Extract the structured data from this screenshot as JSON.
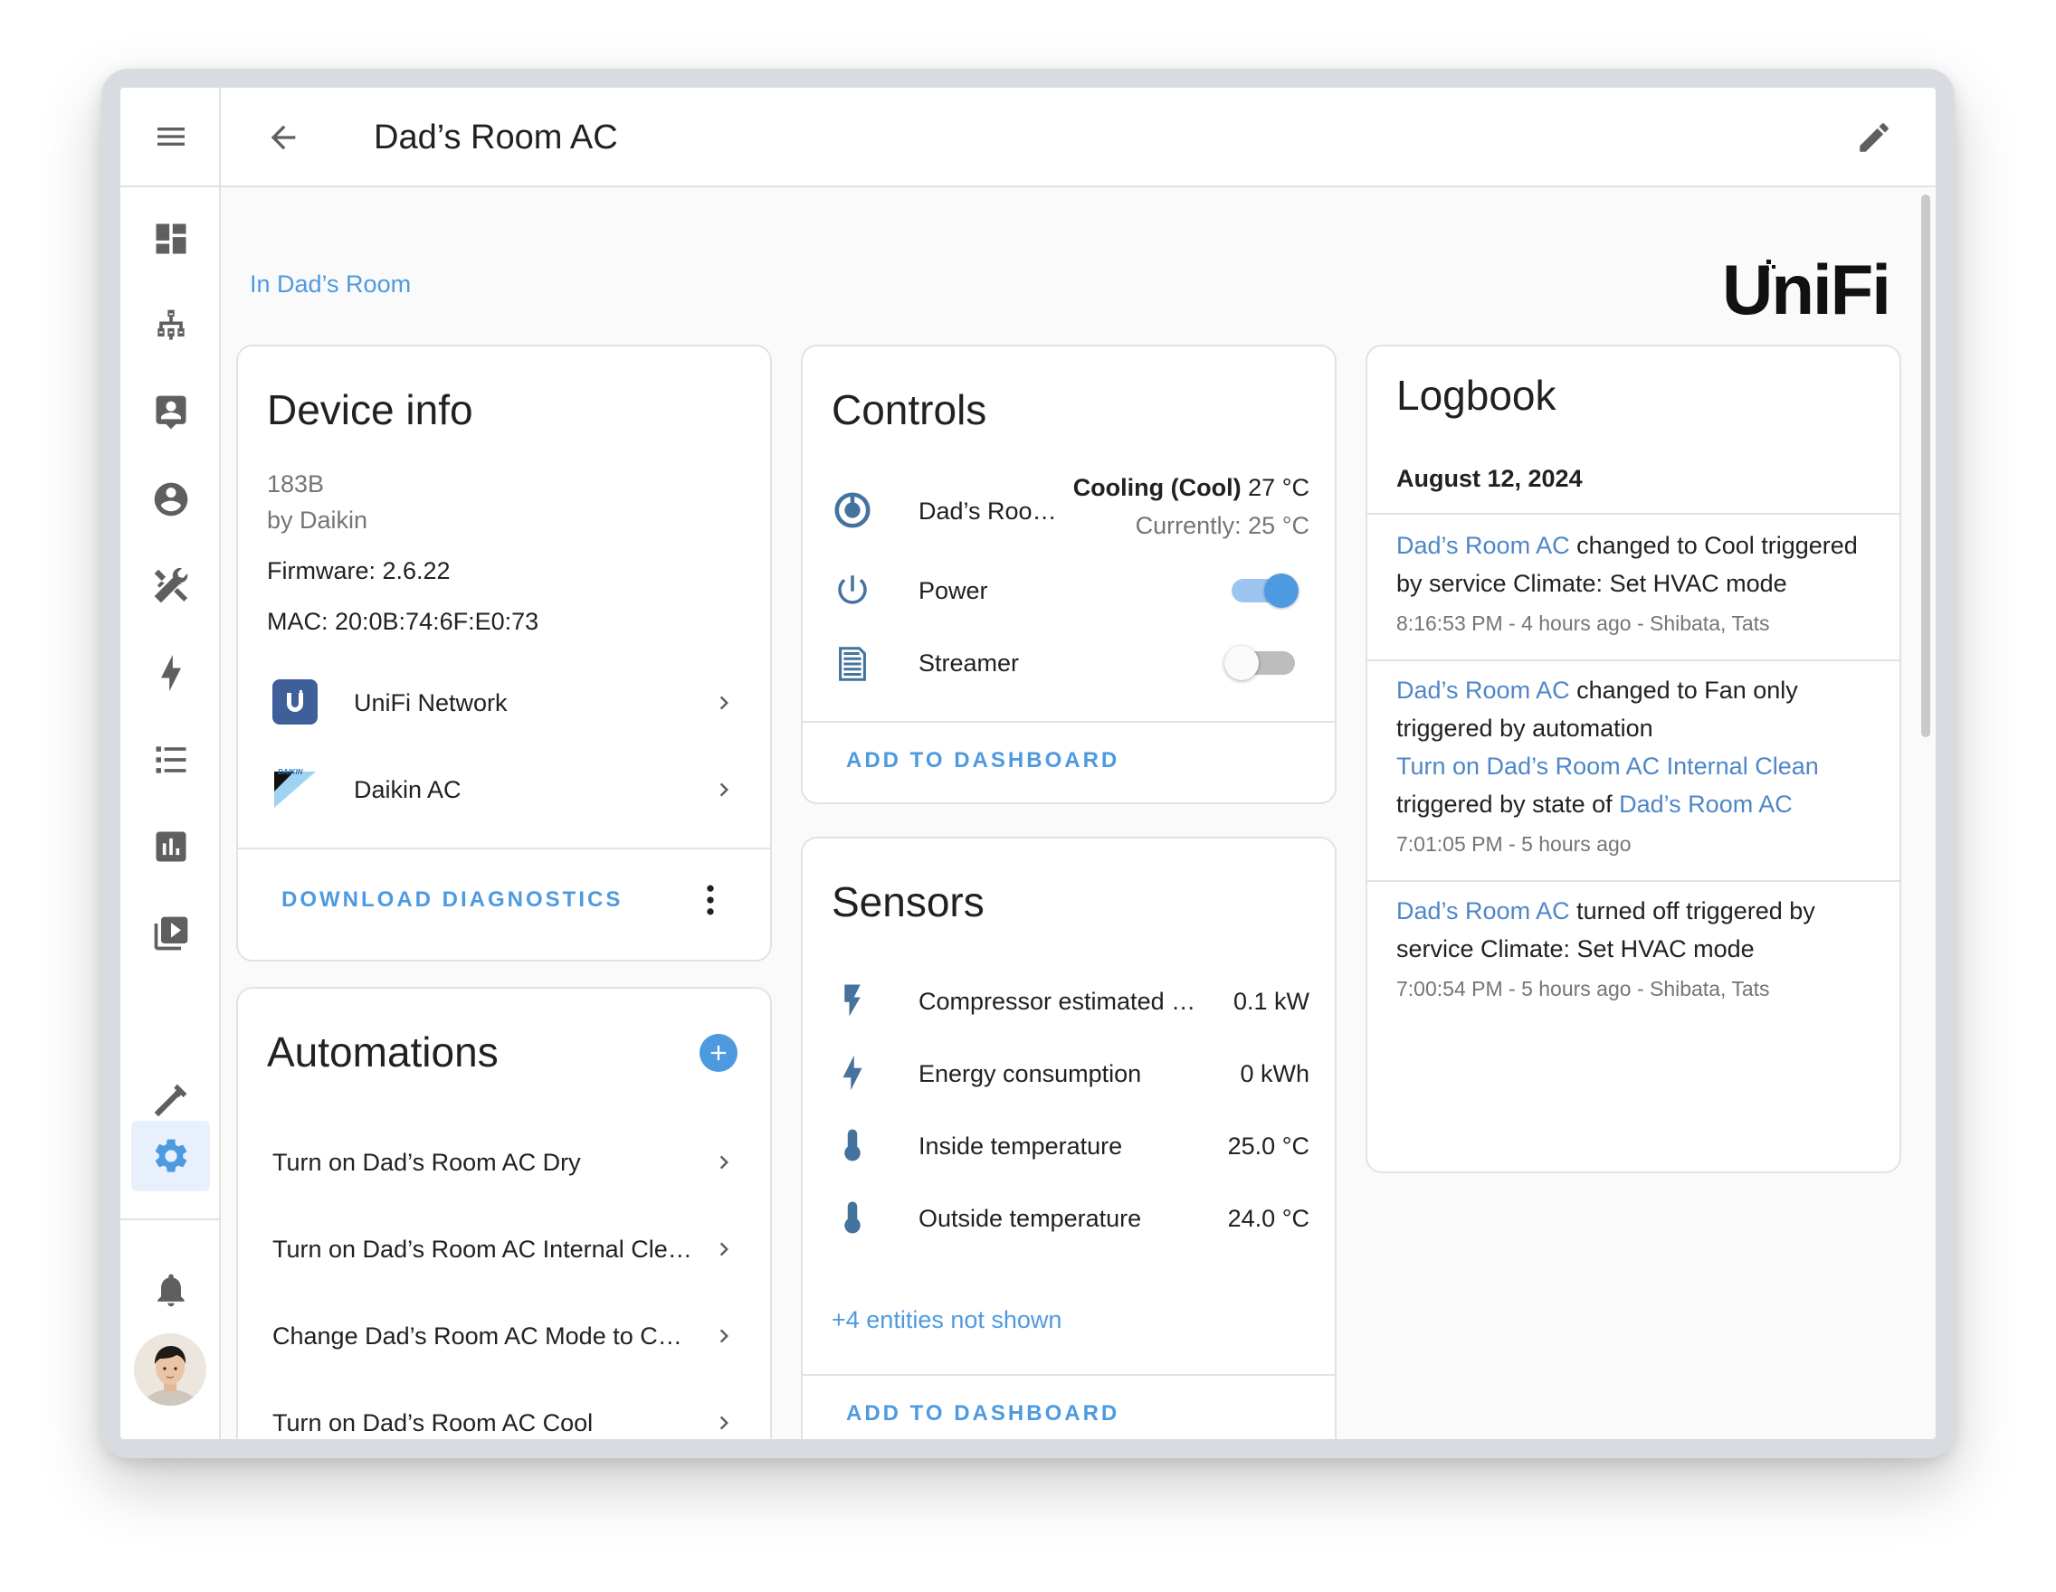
{
  "app": {
    "title": "Dad’s Room AC"
  },
  "sidebar": {
    "items": [
      {
        "name": "overview",
        "icon": "dashboard-icon"
      },
      {
        "name": "network",
        "icon": "network-icon"
      },
      {
        "name": "contacts",
        "icon": "account-box-icon"
      },
      {
        "name": "people",
        "icon": "account-circle-icon"
      },
      {
        "name": "tools",
        "icon": "tools-icon"
      },
      {
        "name": "energy",
        "icon": "lightning-icon"
      },
      {
        "name": "list",
        "icon": "list-icon"
      },
      {
        "name": "history",
        "icon": "chart-icon"
      },
      {
        "name": "media",
        "icon": "media-icon"
      },
      {
        "name": "developer",
        "icon": "hammer-icon"
      },
      {
        "name": "settings",
        "icon": "gear-icon",
        "active": true
      }
    ],
    "notifications_icon": "bell-icon",
    "accent": "#4e9ae0"
  },
  "area": {
    "label": "In Dad’s Room"
  },
  "brand": {
    "logo_text": "UniFi"
  },
  "device_info": {
    "title": "Device info",
    "model": "183B",
    "manufacturer": "by Daikin",
    "firmware": "Firmware: 2.6.22",
    "mac": "MAC: 20:0B:74:6F:E0:73",
    "integrations": [
      {
        "label": "UniFi Network",
        "icon": "unifi-icon"
      },
      {
        "label": "Daikin AC",
        "icon": "daikin-icon"
      }
    ],
    "action": "DOWNLOAD DIAGNOSTICS"
  },
  "automations": {
    "title": "Automations",
    "items": [
      "Turn on Dad’s Room AC Dry",
      "Turn on Dad’s Room AC Internal Cle…",
      "Change Dad’s Room AC Mode to C…",
      "Turn on Dad’s Room AC Cool"
    ]
  },
  "controls": {
    "title": "Controls",
    "climate": {
      "name": "Dad’s Roo…",
      "state_bold": "Cooling (Cool)",
      "state_temp": "27 °C",
      "current": "Currently: 25 °C"
    },
    "switches": [
      {
        "name": "Power",
        "on": true
      },
      {
        "name": "Streamer",
        "on": false
      }
    ],
    "action": "ADD TO DASHBOARD"
  },
  "sensors": {
    "title": "Sensors",
    "items": [
      {
        "name": "Compressor estimated …",
        "value": "0.1 kW",
        "icon": "flash-icon"
      },
      {
        "name": "Energy consumption",
        "value": "0 kWh",
        "icon": "lightning-icon"
      },
      {
        "name": "Inside temperature",
        "value": "25.0 °C",
        "icon": "thermometer-icon"
      },
      {
        "name": "Outside temperature",
        "value": "24.0 °C",
        "icon": "thermometer-icon"
      }
    ],
    "more": "+4 entities not shown",
    "action": "ADD TO DASHBOARD"
  },
  "logbook": {
    "title": "Logbook",
    "date": "August 12, 2024",
    "entries": [
      {
        "entity": "Dad’s Room AC",
        "text1": " changed to Cool triggered",
        "line2": "by service Climate: Set HVAC mode",
        "meta": "8:16:53 PM - 4 hours ago - Shibata, Tats"
      },
      {
        "entity": "Dad’s Room AC",
        "text1": " changed to Fan only",
        "line2": "triggered by automation",
        "automation": "Turn on Dad’s Room AC Internal Clean",
        "line4": "triggered by state of ",
        "entity2": "Dad’s Room AC",
        "meta": "7:01:05 PM - 5 hours ago"
      },
      {
        "entity": "Dad’s Room AC",
        "text1": " turned off triggered by",
        "line2": "service Climate: Set HVAC mode",
        "meta": "7:00:54 PM - 5 hours ago - Shibata, Tats"
      }
    ]
  }
}
